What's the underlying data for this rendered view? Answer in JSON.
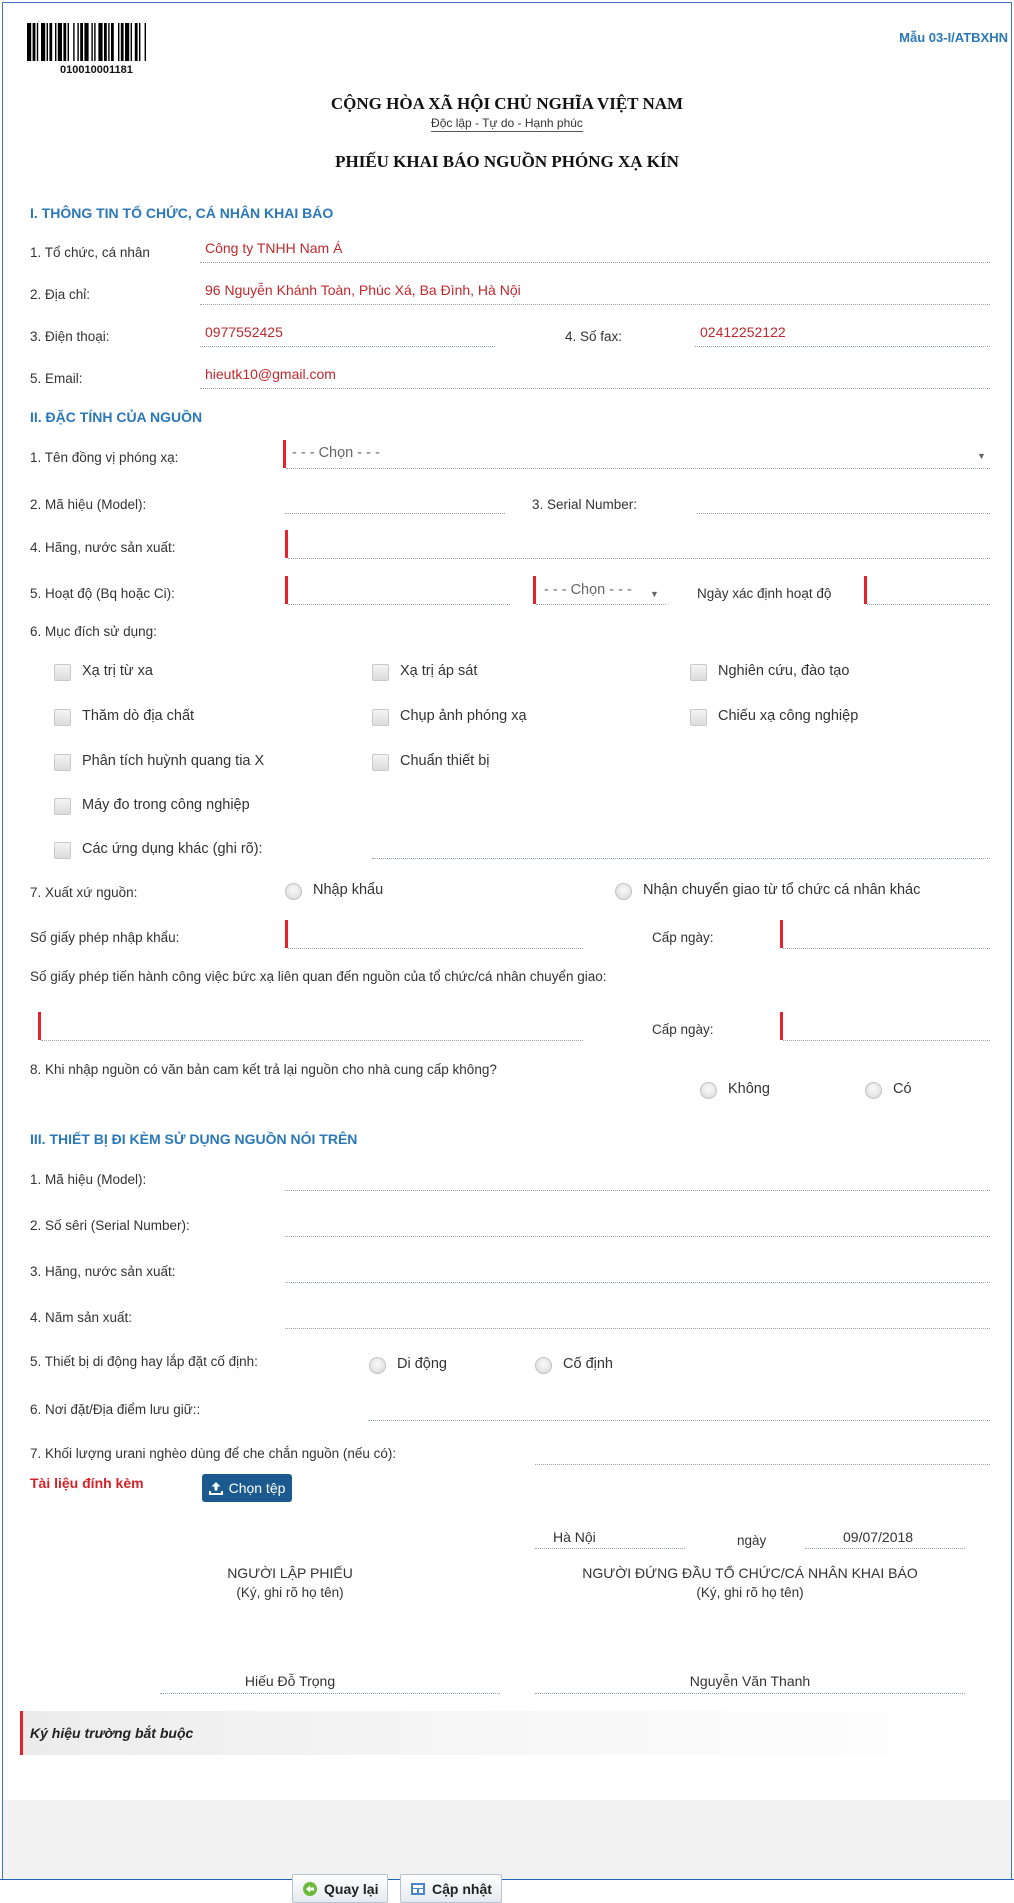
{
  "header": {
    "barcode_number": "010010001181",
    "form_code": "Mẫu 03-I/ATBXHN",
    "nation": "CỘNG HÒA XÃ HỘI CHỦ NGHĨA VIỆT NAM",
    "motto": "Độc lập - Tự do - Hạnh phúc",
    "form_title": "PHIẾU KHAI BÁO NGUỒN PHÓNG XẠ KÍN"
  },
  "section1": {
    "title": "I. THÔNG TIN TỔ CHỨC, CÁ NHÂN KHAI BÁO",
    "org_label": "1. Tổ chức, cá nhân",
    "org_value": "Công ty TNHH Nam Á",
    "address_label": "2. Địa chỉ:",
    "address_value": "96 Nguyễn Khánh Toàn, Phúc Xá, Ba Đình, Hà Nội",
    "phone_label": "3. Điện thoại:",
    "phone_value": "0977552425",
    "fax_label": "4. Số fax:",
    "fax_value": "02412252122",
    "email_label": "5. Email:",
    "email_value": "hieutk10@gmail.com"
  },
  "section2": {
    "title": "II. ĐẶC TÍNH CỦA NGUỒN",
    "isotope_label": "1. Tên đồng vị phóng xạ:",
    "select_placeholder": "- - - Chọn - - -",
    "model_label": "2. Mã hiệu (Model):",
    "serial_label": "3. Serial Number:",
    "maker_label": "4. Hãng, nước sản xuất:",
    "activity_label": "5. Hoạt độ (Bq hoặc Ci):",
    "activity_date_label": "Ngày xác định hoạt độ",
    "purpose_label": "6. Mục đích sử dụng:",
    "purposes": [
      "Xạ trị từ xa",
      "Xạ trị áp sát",
      "Nghiên cứu, đào tạo",
      "Thăm dò địa chất",
      "Chụp ảnh phóng xạ",
      "Chiếu xạ công nghiệp",
      "Phân tích huỳnh quang tia X",
      "Chuẩn thiết bị",
      "Máy đo trong công nghiệp",
      "Các ứng dụng khác (ghi rõ):"
    ],
    "origin_label": "7. Xuất xứ nguồn:",
    "origin_import": "Nhập khẩu",
    "origin_transfer": "Nhận chuyển giao từ tổ chức cá nhân khác",
    "import_permit_label": "Số giấy phép nhập khẩu:",
    "issued_date_label": "Cấp ngày:",
    "transfer_permit_label": "Số giấy phép tiến hành công việc bức xạ liên quan đến nguồn của tổ chức/cá nhân chuyển giao:",
    "return_label": "8. Khi nhập nguồn có văn bản cam kết trả lại nguồn cho nhà cung cấp không?",
    "return_no": "Không",
    "return_yes": "Có"
  },
  "section3": {
    "title": "III. THIẾT BỊ ĐI KÈM SỬ DỤNG NGUỒN NÓI TRÊN",
    "model_label": "1. Mã hiệu (Model):",
    "serial_label": "2. Số sêri (Serial Number):",
    "maker_label": "3. Hãng, nước sản xuất:",
    "year_label": "4. Năm sản xuất:",
    "mobility_label": "5. Thiết bị di động hay lắp đặt cố định:",
    "mobile": "Di động",
    "fixed": "Cố định",
    "location_label": "6. Nơi đặt/Địa điểm lưu giữ::",
    "uranium_label": "7. Khối lượng urani nghèo dùng để che chắn nguồn (nếu có):"
  },
  "attachment": {
    "label": "Tài liệu đính kèm",
    "button": "Chọn tệp"
  },
  "signature": {
    "place": "Hà Nội",
    "day_label": "ngày",
    "date": "09/07/2018",
    "preparer_title": "NGƯỜI LẬP PHIẾU",
    "preparer_note": "(Ký, ghi rõ họ tên)",
    "preparer_name": "Hiếu Đỗ Trọng",
    "head_title": "NGƯỜI ĐỨNG ĐẦU TỔ CHỨC/CÁ NHÂN KHAI BÁO",
    "head_note": "(Ký, ghi rõ họ tên)",
    "head_name": "Nguyễn Văn Thanh"
  },
  "legend": "Ký hiệu trường bắt buộc",
  "footer": {
    "back": "Quay lại",
    "update": "Cập nhật"
  },
  "colors": {
    "accent": "#2b78b8",
    "required": "#e3232b",
    "value": "#c0282d"
  }
}
